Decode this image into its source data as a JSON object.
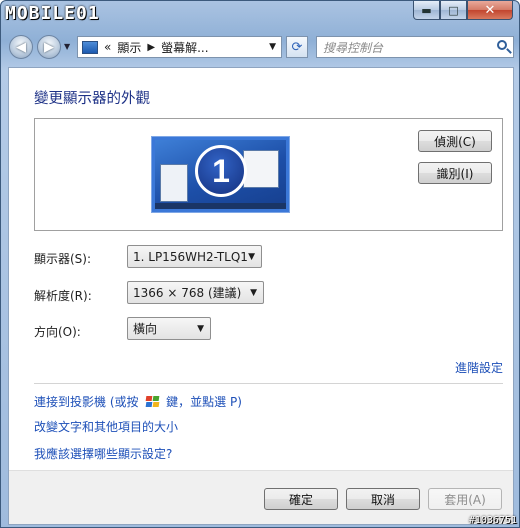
{
  "watermark": "MOBILE01",
  "window_controls": {
    "minimize": "▬",
    "maximize": "□",
    "close": "✕"
  },
  "nav": {
    "back_icon": "◀",
    "forward_icon": "▶",
    "breadcrumb_prefix": "«",
    "breadcrumb": [
      "顯示",
      "螢幕解..."
    ],
    "search_placeholder": "搜尋控制台",
    "refresh_icon": "⟳"
  },
  "main": {
    "heading": "變更顯示器的外觀",
    "preview": {
      "monitor_number": "1"
    },
    "detect_button": "偵測(C)",
    "identify_button": "識別(I)",
    "display_label": "顯示器(S):",
    "display_value": "1. LP156WH2-TLQ1",
    "resolution_label": "解析度(R):",
    "resolution_value": "1366 × 768 (建議)",
    "orientation_label": "方向(O):",
    "orientation_value": "橫向",
    "advanced_link": "進階設定",
    "links": {
      "projector_prefix": "連接到投影機 (或按",
      "projector_suffix": "鍵，並點選 P)",
      "text_size": "改變文字和其他項目的大小",
      "which_settings": "我應該選擇哪些顯示設定?"
    }
  },
  "footer": {
    "ok": "確定",
    "cancel": "取消",
    "apply": "套用(A)"
  },
  "image_tag": "#1036751"
}
